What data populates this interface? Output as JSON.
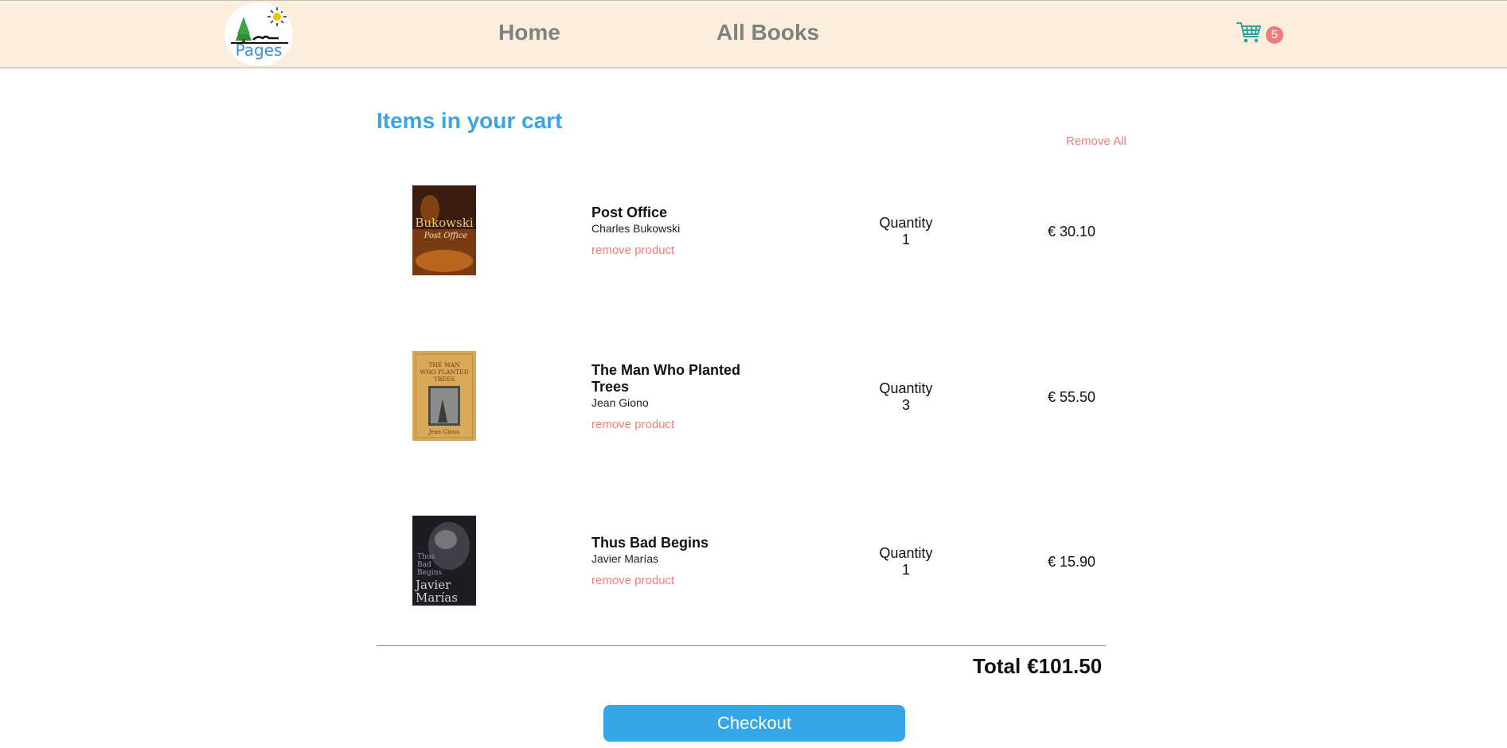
{
  "header": {
    "logo_text": "Pages",
    "nav": [
      {
        "label": "Home"
      },
      {
        "label": "All Books"
      }
    ],
    "cart_icon": "shopping-cart-icon",
    "cart_count": "5"
  },
  "cart": {
    "title": "Items in your cart",
    "remove_all_label": "Remove All",
    "quantity_label": "Quantity",
    "remove_label": "remove product",
    "items": [
      {
        "title": "Post Office",
        "author": "Charles Bukowski",
        "quantity": "1",
        "price": "€ 30.10",
        "cover_lines": [
          "Bukowski",
          "Post Office"
        ]
      },
      {
        "title": "The Man Who Planted Trees",
        "author": "Jean Giono",
        "quantity": "3",
        "price": "€ 55.50",
        "cover_lines": [
          "THE MAN",
          "WHO PLANTED",
          "TREES",
          "Jean Giono"
        ]
      },
      {
        "title": "Thus Bad Begins",
        "author": "Javier Marías",
        "quantity": "1",
        "price": "€ 15.90",
        "cover_lines": [
          "Thus",
          "Bad",
          "Begins",
          "Javier",
          "Marías"
        ]
      }
    ],
    "total_label": "Total",
    "total_value": "€101.50",
    "checkout_label": "Checkout"
  },
  "colors": {
    "navbar_bg": "#fbeedd",
    "accent_blue": "#36a6e8",
    "remove_red": "#f07d7d",
    "cart_icon": "#2aa39a"
  }
}
